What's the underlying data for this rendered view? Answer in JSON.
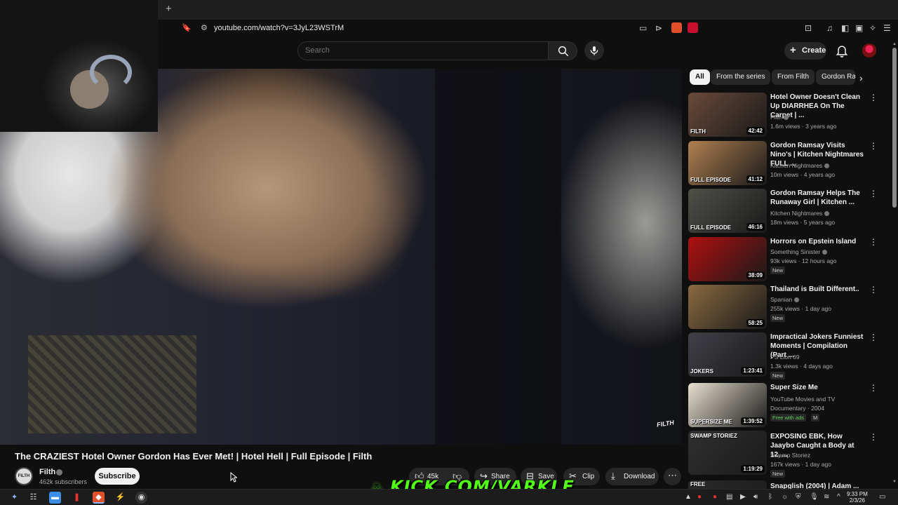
{
  "browser": {
    "new_tab": "+",
    "url": "youtube.com/watch?v=3JyL23WSTrM"
  },
  "header": {
    "search_placeholder": "Search",
    "create_label": "Create"
  },
  "video": {
    "title": "The CRAZIEST Hotel Owner Gordon Has Ever Met! | Hotel Hell | Full Episode | Filth",
    "watermark": "FILTH",
    "channel": "Filth",
    "channel_avatar_text": "FILTH",
    "subscribers": "462k subscribers",
    "subscribe_label": "Subscribe",
    "likes": "45k",
    "share_label": "Share",
    "save_label": "Save",
    "clip_label": "Clip",
    "download_label": "Download",
    "kick_overlay": "KICK.COM/VARKLE"
  },
  "chips": [
    "All",
    "From the series",
    "From Filth",
    "Gordon Ra"
  ],
  "recommendations": [
    {
      "title": "Hotel Owner Doesn't Clean Up DIARRHEA On The Carpet | ...",
      "channel": "Filth",
      "meta": "1.6m views · 3 years ago",
      "duration": "42:42",
      "caption": "FILTH",
      "badge": ""
    },
    {
      "title": "Gordon Ramsay Visits Nino's | Kitchen Nightmares FULL ...",
      "channel": "Kitchen Nightmares",
      "meta": "10m views · 4 years ago",
      "duration": "41:12",
      "caption": "FULL EPISODE",
      "badge": ""
    },
    {
      "title": "Gordon Ramsay Helps The Runaway Girl | Kitchen ...",
      "channel": "Kitchen Nightmares",
      "meta": "18m views · 5 years ago",
      "duration": "46:16",
      "caption": "FULL EPISODE",
      "badge": ""
    },
    {
      "title": "Horrors on Epstein Island",
      "channel": "Something Sinister",
      "meta": "93k views · 12 hours ago",
      "duration": "38:09",
      "caption": "",
      "badge": "New"
    },
    {
      "title": "Thailand is Built Different..",
      "channel": "Spanian",
      "meta": "255k views · 1 day ago",
      "duration": "58:25",
      "caption": "",
      "badge": "New"
    },
    {
      "title": "Impractical Jokers Funniest Moments | Compilation (Part ...",
      "channel": "PS Lion 69",
      "meta": "1.3k views · 4 days ago",
      "duration": "1:23:41",
      "caption": "JOKERS",
      "badge": "New"
    },
    {
      "title": "Super Size Me",
      "channel": "YouTube Movies and TV",
      "meta": "Documentary · 2004",
      "duration": "1:39:52",
      "caption": "SUPERSIZE ME",
      "badge": "Free with ads",
      "rating": "M"
    },
    {
      "title": "EXPOSING EBK, How Jaaybo Caught a Body at 12, ...",
      "channel": "Swamp Storiez",
      "meta": "167k views · 1 day ago",
      "duration": "1:19:29",
      "caption": "SWAMP STORIEZ",
      "badge": "New"
    },
    {
      "title": "Snapglish (2004) | Adam ...",
      "channel": "",
      "meta": "",
      "duration": "",
      "caption": "FREE",
      "badge": ""
    }
  ],
  "thumb_colors": [
    "#6a4a3a",
    "#b08050",
    "#50504a",
    "#b01010",
    "#8a6a40",
    "#404048",
    "#e8e0d0",
    "#303030",
    "#2a2a2a"
  ],
  "taskbar": {
    "time": "9:33 PM",
    "date": "2/3/26"
  }
}
